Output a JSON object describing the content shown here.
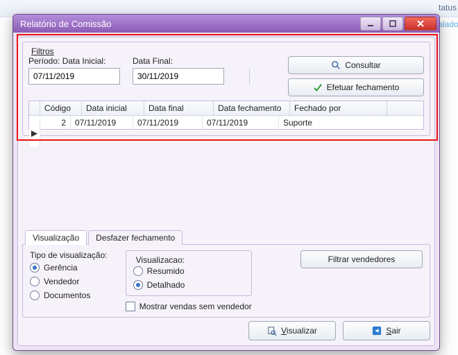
{
  "bg": {
    "tatus": "tatus",
    "talado": "talado"
  },
  "window": {
    "title": "Relatório de Comissão"
  },
  "filters": {
    "legend": "Filtros",
    "periodo_label": "Período:",
    "data_inicial_label": "Data Inicial:",
    "data_final_label": "Data Final:",
    "data_inicial_value": "07/11/2019",
    "data_final_value": "30/11/2019",
    "consultar": "Consultar",
    "efetuar": "Efetuar fechamento"
  },
  "grid": {
    "headers": {
      "codigo": "Código",
      "data_inicial": "Data inicial",
      "data_final": "Data final",
      "data_fechamento": "Data fechamento",
      "fechado_por": "Fechado por"
    },
    "rows": [
      {
        "codigo": "2",
        "data_inicial": "07/11/2019",
        "data_final": "07/11/2019",
        "data_fechamento": "07/11/2019",
        "fechado_por": "Suporte"
      }
    ]
  },
  "tabs": {
    "visualizacao": "Visualização",
    "desfazer": "Desfazer fechamento"
  },
  "viz": {
    "tipo_legend": "Tipo de visualização:",
    "gerencia": "Gerência",
    "vendedor": "Vendedor",
    "documentos": "Documentos",
    "viz_legend": "Visualizacao:",
    "resumido": "Resumido",
    "detalhado": "Detalhado",
    "mostrar_sem_vend": "Mostrar vendas sem vendedor",
    "filtrar_vend": "Filtrar vendedores"
  },
  "footer": {
    "visualizar_pre": "V",
    "visualizar_post": "isualizar",
    "sair_pre": "S",
    "sair_post": "air"
  }
}
